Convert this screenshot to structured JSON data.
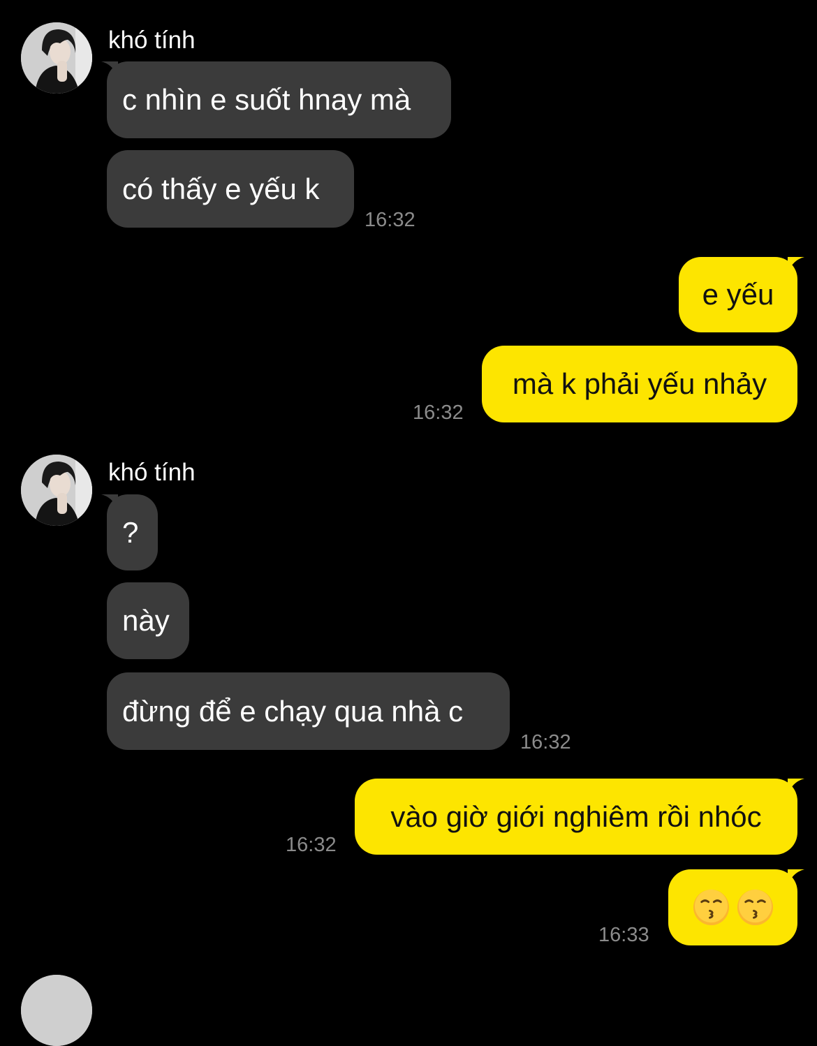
{
  "colors": {
    "background": "#000000",
    "incoming_bubble": "#3b3b3b",
    "outgoing_bubble": "#fde500",
    "timestamp": "#8b8b8b"
  },
  "contact": {
    "name": "khó tính",
    "avatar_icon": "profile-photo"
  },
  "messages": [
    {
      "group": 1,
      "side": "incoming",
      "sender": "khó tính",
      "text": "c nhìn e suốt hnay mà"
    },
    {
      "group": 1,
      "side": "incoming",
      "text": "có thấy e yếu k",
      "time": "16:32"
    },
    {
      "group": 2,
      "side": "outgoing",
      "text": "e yếu"
    },
    {
      "group": 2,
      "side": "outgoing",
      "text": "mà k phải yếu nhảy",
      "time": "16:32"
    },
    {
      "group": 3,
      "side": "incoming",
      "sender": "khó tính",
      "text": "?"
    },
    {
      "group": 3,
      "side": "incoming",
      "text": "này"
    },
    {
      "group": 3,
      "side": "incoming",
      "text": "đừng để e chạy qua nhà c",
      "time": "16:32"
    },
    {
      "group": 4,
      "side": "outgoing",
      "text": "vào giờ giới nghiêm rồi nhóc",
      "time": "16:32"
    },
    {
      "group": 4,
      "side": "outgoing",
      "text": "😗😗",
      "emoji_icons": [
        "kissing-face-icon",
        "kissing-face-icon"
      ],
      "time": "16:33"
    }
  ]
}
